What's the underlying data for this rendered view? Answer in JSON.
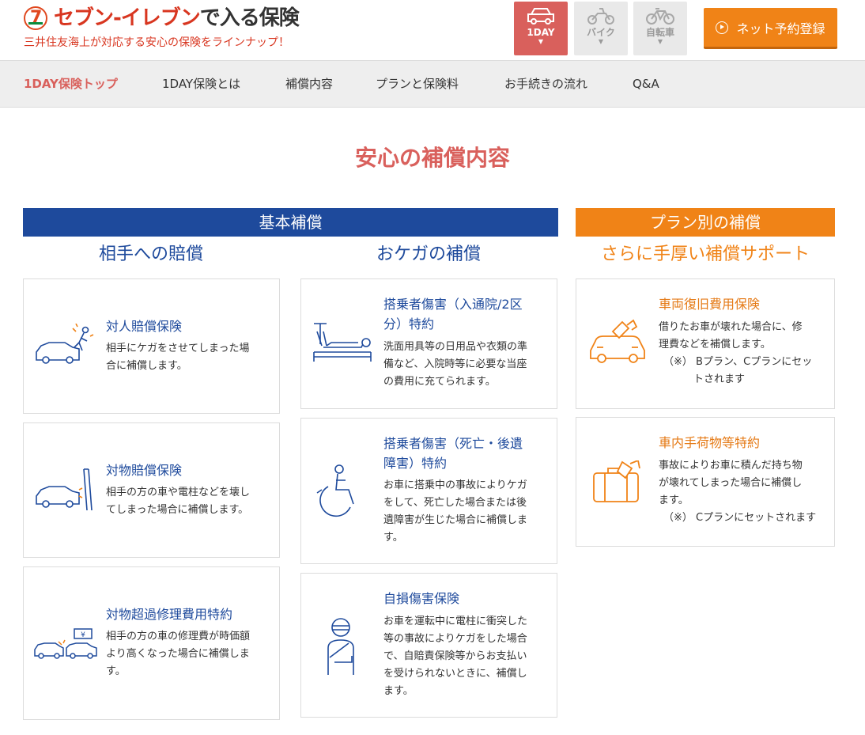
{
  "header": {
    "logo_brand": "セブン-イレブン",
    "logo_tail": "で入る保険",
    "subtitle": "三井住友海上が対応する安心の保険をラインナップ！",
    "vehicle_tabs": [
      {
        "label": "1DAY",
        "icon": "car-icon",
        "active": true
      },
      {
        "label": "バイク",
        "icon": "motorbike-icon",
        "active": false
      },
      {
        "label": "自転車",
        "icon": "bicycle-icon",
        "active": false
      }
    ],
    "register_button": "ネット予約登録"
  },
  "nav": {
    "items": [
      "1DAY保険トップ",
      "1DAY保険とは",
      "補償内容",
      "プランと保険料",
      "お手続きの流れ",
      "Q&A"
    ],
    "active": "1DAY保険トップ"
  },
  "main": {
    "title": "安心の補償内容",
    "basic_band": "基本補償",
    "plan_band": "プラン別の補償",
    "col_liability": "相手への賠償",
    "col_injury": "おケガの補償",
    "col_plan": "さらに手厚い補償サポート",
    "cards": {
      "personal": {
        "title": "対人賠償保険",
        "desc": [
          "相手にケガをさせてしまった場",
          "合に補償します。"
        ],
        "icon": "car-hit-person-icon"
      },
      "property": {
        "title": "対物賠償保険",
        "desc": [
          "相手の方の車や電柱などを壊し",
          "てしまった場合に補償します。"
        ],
        "icon": "car-hit-pole-icon"
      },
      "excess": {
        "title": "対物超過修理費用特約",
        "desc": [
          "相手の方の車の修理費が時価額",
          "より高くなった場合に補償しま",
          "す。"
        ],
        "icon": "car-collision-yen-icon"
      },
      "passenger_hosp": {
        "title_lines": [
          "搭乗者傷害（入通院/2区",
          "分）特約"
        ],
        "desc": [
          "洗面用具等の日用品や衣類の準",
          "備など、入院時等に必要な当座",
          "の費用に充てられます。"
        ],
        "icon": "hospital-bed-icon"
      },
      "passenger_death": {
        "title_lines": [
          "搭乗者傷害（死亡・後遺",
          "障害）特約"
        ],
        "desc": [
          "お車に搭乗中の事故によりケガ",
          "をして、死亡した場合または後",
          "遺障害が生じた場合に補償しま",
          "す。"
        ],
        "icon": "wheelchair-icon"
      },
      "self_injury": {
        "title": "自損傷害保険",
        "desc": [
          "お車を運転中に電柱に衝突した",
          "等の事故によりケガをした場合",
          "で、自賠責保険等からお支払い",
          "を受けられないときに、補償し",
          "ます。"
        ],
        "icon": "bandaged-person-icon"
      },
      "vehicle_recovery": {
        "title": "車両復旧費用保険",
        "desc": [
          "借りたお車が壊れた場合に、修",
          "理費などを補償します。"
        ],
        "note": [
          "（※） Bプラン、Cプランにセッ",
          "トされます"
        ],
        "icon": "damaged-car-icon"
      },
      "luggage": {
        "title": "車内手荷物等特約",
        "desc": [
          "事故によりお車に積んだ持ち物",
          "が壊れてしまった場合に補償し",
          "ます。"
        ],
        "note": [
          "（※） Cプランにセットされます"
        ],
        "icon": "broken-suitcase-icon"
      }
    }
  },
  "colors": {
    "brand_red": "#d83620",
    "accent_red": "#d9605c",
    "blue": "#1e4a9c",
    "orange": "#f08317"
  }
}
